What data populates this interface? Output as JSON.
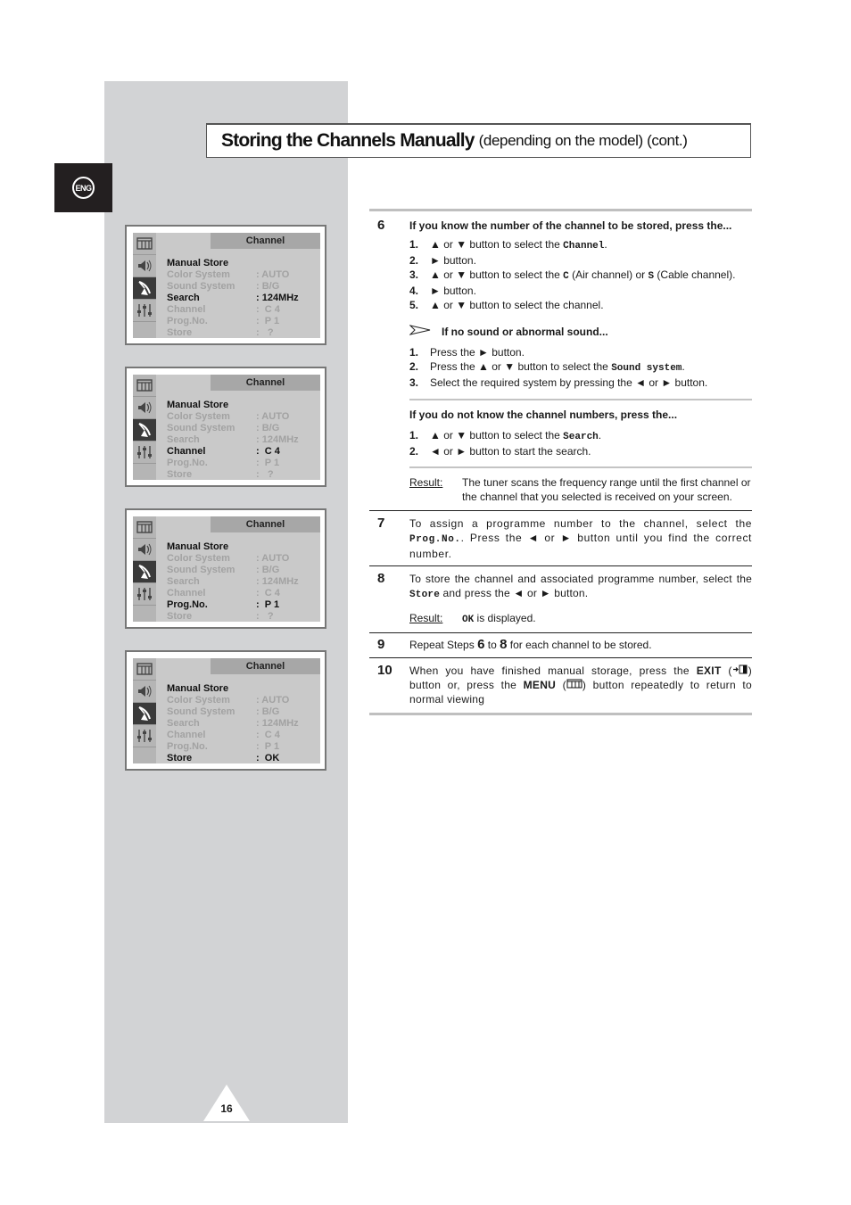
{
  "page": {
    "language_badge": "ENG",
    "title_main": "Storing the Channels Manually",
    "title_sub": "(depending on the model) (cont.)",
    "page_number": "16"
  },
  "osd_screens": [
    {
      "header": "Channel",
      "title": "Manual Store",
      "active_icon": "antenna",
      "rows": [
        {
          "label": "Color System",
          "value": ": AUTO",
          "highlight": false
        },
        {
          "label": "Sound System",
          "value": ": B/G",
          "highlight": false
        },
        {
          "label": "Search",
          "value": ": 124MHz",
          "highlight": true
        },
        {
          "label": "Channel",
          "value": ":  C 4",
          "highlight": false
        },
        {
          "label": "Prog.No.",
          "value": ":  P 1",
          "highlight": false
        },
        {
          "label": "Store",
          "value": ":   ?",
          "highlight": false
        }
      ]
    },
    {
      "header": "Channel",
      "title": "Manual Store",
      "active_icon": "antenna",
      "rows": [
        {
          "label": "Color System",
          "value": ": AUTO",
          "highlight": false
        },
        {
          "label": "Sound System",
          "value": ": B/G",
          "highlight": false
        },
        {
          "label": "Search",
          "value": ": 124MHz",
          "highlight": false
        },
        {
          "label": "Channel",
          "value": ":  C 4",
          "highlight": true
        },
        {
          "label": "Prog.No.",
          "value": ":  P 1",
          "highlight": false
        },
        {
          "label": "Store",
          "value": ":   ?",
          "highlight": false
        }
      ]
    },
    {
      "header": "Channel",
      "title": "Manual Store",
      "active_icon": "antenna",
      "rows": [
        {
          "label": "Color System",
          "value": ": AUTO",
          "highlight": false
        },
        {
          "label": "Sound System",
          "value": ": B/G",
          "highlight": false
        },
        {
          "label": "Search",
          "value": ": 124MHz",
          "highlight": false
        },
        {
          "label": "Channel",
          "value": ":  C 4",
          "highlight": false
        },
        {
          "label": "Prog.No.",
          "value": ":  P 1",
          "highlight": true
        },
        {
          "label": "Store",
          "value": ":   ?",
          "highlight": false
        }
      ]
    },
    {
      "header": "Channel",
      "title": "Manual Store",
      "active_icon": "antenna",
      "rows": [
        {
          "label": "Color System",
          "value": ": AUTO",
          "highlight": false
        },
        {
          "label": "Sound System",
          "value": ": B/G",
          "highlight": false
        },
        {
          "label": "Search",
          "value": ": 124MHz",
          "highlight": false
        },
        {
          "label": "Channel",
          "value": ":  C 4",
          "highlight": false
        },
        {
          "label": "Prog.No.",
          "value": ":  P 1",
          "highlight": false
        },
        {
          "label": "Store",
          "value": ":  OK",
          "highlight": true
        }
      ]
    }
  ],
  "step6": {
    "num": "6",
    "heading": "If you know the number of the channel to be stored, press the...",
    "items": [
      {
        "n": "1.",
        "pre": "▲ or ▼ button to select the ",
        "code": "Channel",
        "post": "."
      },
      {
        "n": "2.",
        "pre": "► button.",
        "code": "",
        "post": ""
      },
      {
        "n": "3.",
        "pre": "▲ or ▼ button to select the ",
        "code": "C",
        "post": " (Air channel) or ",
        "code2": "S",
        "post2": " (Cable channel)."
      },
      {
        "n": "4.",
        "pre": "► button.",
        "code": "",
        "post": ""
      },
      {
        "n": "5.",
        "pre": "▲ or ▼ button to select the channel.",
        "code": "",
        "post": ""
      }
    ],
    "note_heading": "If no sound or abnormal sound...",
    "note_items": [
      {
        "n": "1.",
        "pre": "Press the ► button.",
        "code": "",
        "post": ""
      },
      {
        "n": "2.",
        "pre": "Press the ▲ or ▼ button to select the ",
        "code": "Sound system",
        "post": "."
      },
      {
        "n": "3.",
        "pre": "Select the required system by pressing the ◄ or ► button.",
        "code": "",
        "post": ""
      }
    ],
    "unknown_heading": "If you do not know the channel numbers, press the...",
    "unknown_items": [
      {
        "n": "1.",
        "pre": "▲ or ▼ button to select the ",
        "code": "Search",
        "post": "."
      },
      {
        "n": "2.",
        "pre": "◄ or ► button to start the search.",
        "code": "",
        "post": ""
      }
    ],
    "result_label": "Result:",
    "result_text": "The tuner scans the frequency range until the first channel or the channel that you selected is received on your screen."
  },
  "step7": {
    "num": "7",
    "pre": "To assign a programme number to the channel, select the ",
    "code": "Prog.No.",
    "post": ". Press the ◄ or ► button until you find the correct number."
  },
  "step8": {
    "num": "8",
    "pre": "To store the channel and associated programme number, select the ",
    "code": "Store",
    "post": " and press the ◄ or ► button.",
    "result_label": "Result:",
    "result_code": "OK",
    "result_text": " is displayed."
  },
  "step9": {
    "num": "9",
    "pre": "Repeat Steps ",
    "from": "6",
    "mid": " to ",
    "to": "8",
    "post": " for each channel to be stored."
  },
  "step10": {
    "num": "10",
    "pre": "When you have finished manual storage, press the ",
    "exit_label": "EXIT",
    "mid": " button or, press the ",
    "menu_label": "MENU",
    "post": " button repeatedly to return to normal viewing"
  }
}
